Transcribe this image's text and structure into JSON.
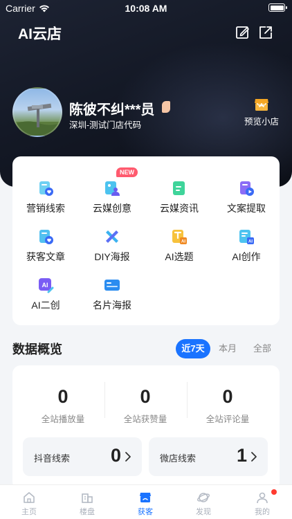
{
  "status_bar": {
    "carrier": "Carrier",
    "time": "10:08 AM"
  },
  "header": {
    "app_title": "AI云店",
    "edit_icon": "edit-icon",
    "share_icon": "share-icon"
  },
  "profile": {
    "name": "陈彼不纠***员",
    "store": "深圳-测试门店代码",
    "preview_label": "预览小店"
  },
  "features": {
    "new_badge": "NEW",
    "items": [
      {
        "label": "营销线索",
        "icon": "doc-heart-icon",
        "color": "#2ab3e6"
      },
      {
        "label": "云媒创意",
        "icon": "image-person-icon",
        "color": "#26b6e8"
      },
      {
        "label": "云媒资讯",
        "icon": "doc-green-icon",
        "color": "#22c47a"
      },
      {
        "label": "文案提取",
        "icon": "doc-play-icon",
        "color": "#7a5cf4"
      },
      {
        "label": "获客文章",
        "icon": "doc-heart-blue-icon",
        "color": "#2ab3e6"
      },
      {
        "label": "DIY海报",
        "icon": "brush-icon",
        "color": "#29a8e8"
      },
      {
        "label": "AI选题",
        "icon": "ai-topic-icon",
        "color": "#f5b324"
      },
      {
        "label": "AI创作",
        "icon": "ai-create-icon",
        "color": "#2ab3e6"
      },
      {
        "label": "AI二创",
        "icon": "ai-remix-icon",
        "color": "#6e5ff0"
      },
      {
        "label": "名片海报",
        "icon": "card-icon",
        "color": "#2a8cf0"
      }
    ]
  },
  "overview": {
    "title": "数据概览",
    "tabs": [
      "近7天",
      "本月",
      "全部"
    ],
    "active_tab": "近7天",
    "stats": [
      {
        "value": "0",
        "label": "全站播放量"
      },
      {
        "value": "0",
        "label": "全站获赞量"
      },
      {
        "value": "0",
        "label": "全站评论量"
      }
    ],
    "leads": [
      {
        "name": "抖音线索",
        "count": "0"
      },
      {
        "name": "微店线索",
        "count": "1"
      }
    ]
  },
  "tabbar": {
    "items": [
      {
        "label": "主页",
        "icon": "home-icon"
      },
      {
        "label": "楼盘",
        "icon": "building-icon"
      },
      {
        "label": "获客",
        "icon": "store-icon"
      },
      {
        "label": "发现",
        "icon": "planet-icon"
      },
      {
        "label": "我的",
        "icon": "person-icon"
      }
    ],
    "active": "获客"
  },
  "colors": {
    "accent": "#1a73ff",
    "hero_bg": "#141926",
    "notification": "#ff3b30"
  }
}
